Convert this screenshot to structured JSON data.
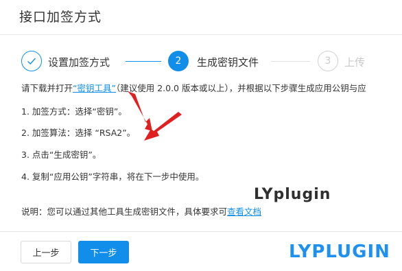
{
  "dialog": {
    "title": "接口加签方式"
  },
  "steps": [
    {
      "number": "1",
      "label": "设置加签方式",
      "state": "done"
    },
    {
      "number": "2",
      "label": "生成密钥文件",
      "state": "active"
    },
    {
      "number": "3",
      "label": "上传",
      "state": "pending"
    }
  ],
  "content": {
    "intro_before": "请下载并打开",
    "intro_link": "“密钥工具”",
    "intro_after": "（建议使用 2.0.0 版本或以上），并根据以下步骤生成应用公钥与应",
    "items": [
      "1. 加签方式：选择“密钥”。",
      "2. 加签算法：选择 “RSA2”。",
      "3. 点击“生成密钥”。",
      "4. 复制“应用公钥”字符串，将在下一步中使用。"
    ],
    "note_before": "说明：您可以通过其他工具生成密钥文件，具体要求可",
    "note_link": "查看文档"
  },
  "watermarks": {
    "top": "LYplugin",
    "bottom": "LYPLUGIN"
  },
  "buttons": {
    "prev": "上一步",
    "next": "下一步"
  },
  "colors": {
    "primary": "#108ee9",
    "annotation_red": "#e02020",
    "muted": "#c8c8c8"
  },
  "icons": {
    "step_done": "check-icon"
  }
}
